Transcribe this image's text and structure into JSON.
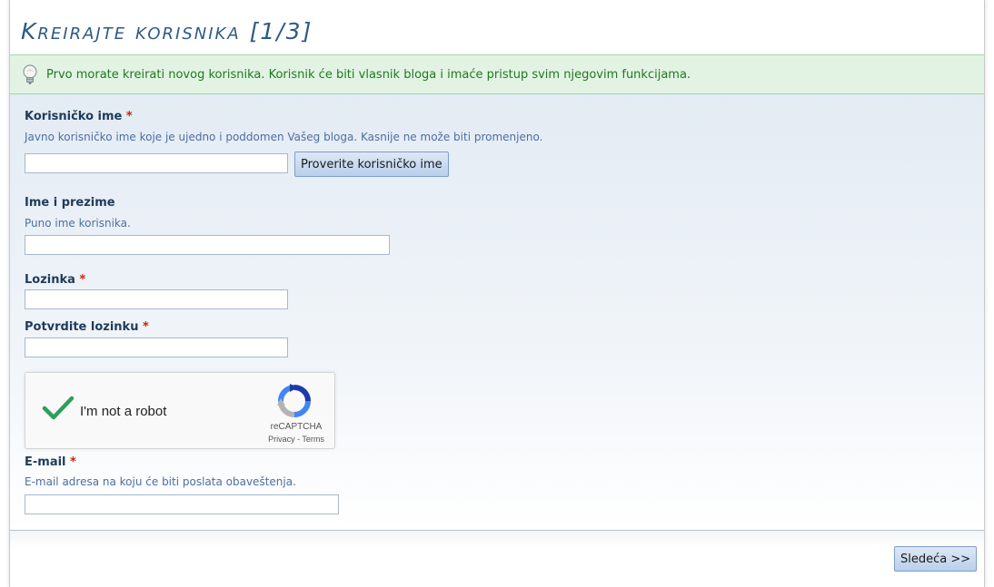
{
  "page": {
    "title": "Kreirajte korisnika [1/3]"
  },
  "notice": {
    "text": "Prvo morate kreirati novog korisnika. Korisnik će biti vlasnik bloga i imaće pristup svim njegovim funkcijama."
  },
  "form": {
    "username": {
      "label": "Korisničko ime",
      "required": "*",
      "hint": "Javno korisničko ime koje je ujedno i poddomen Vašeg bloga. Kasnije ne može biti promenjeno.",
      "value": "",
      "check_button": "Proverite korisničko ime"
    },
    "fullname": {
      "label": "Ime i prezime",
      "hint": "Puno ime korisnika.",
      "value": ""
    },
    "password": {
      "label": "Lozinka",
      "required": "*",
      "value": ""
    },
    "password_confirm": {
      "label": "Potvrdite lozinku",
      "required": "*",
      "value": ""
    },
    "captcha": {
      "text": "I'm not a robot",
      "brand": "reCAPTCHA",
      "links": "Privacy - Terms",
      "checked": true
    },
    "email": {
      "label": "E-mail",
      "required": "*",
      "hint": "E-mail adresa na koju će biti poslata obaveštenja.",
      "value": ""
    }
  },
  "footer": {
    "next_button": "Sledeća >>"
  },
  "colors": {
    "title": "#2d5a85",
    "notice_bg": "#e2f3e4",
    "notice_text": "#1e7a1e",
    "label": "#1f3b5a",
    "hint": "#4d6fa1",
    "required": "#cc2200",
    "captcha_check": "#2e9e5b"
  },
  "icons": {
    "notice": "lightbulb-icon",
    "captcha_check": "checkmark-icon",
    "captcha_logo": "recaptcha-logo-icon"
  }
}
